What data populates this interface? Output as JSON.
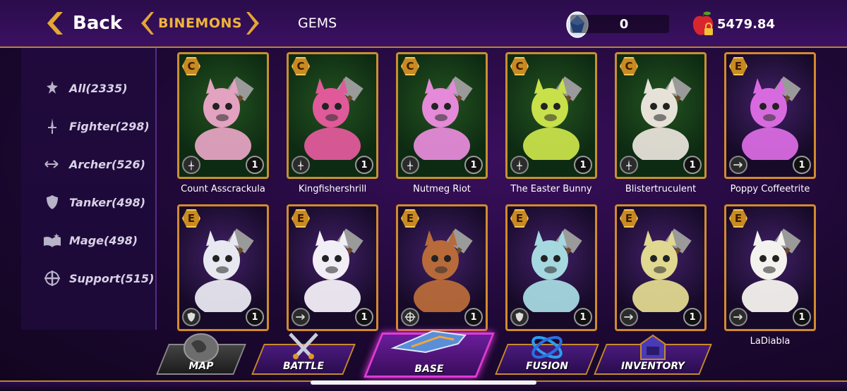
{
  "header": {
    "back_label": "Back",
    "tab_active": "BINEMONS",
    "tab_other": "GEMS",
    "gem_count": "0",
    "coin_balance": "5479.84"
  },
  "filters": [
    {
      "label": "All(2335)",
      "icon": "all-classes-icon"
    },
    {
      "label": "Fighter(298)",
      "icon": "sword-icon"
    },
    {
      "label": "Archer(526)",
      "icon": "arrow-icon"
    },
    {
      "label": "Tanker(498)",
      "icon": "shield-icon"
    },
    {
      "label": "Mage(498)",
      "icon": "spellbook-icon"
    },
    {
      "label": "Support(515)",
      "icon": "cross-icon"
    }
  ],
  "cards": [
    {
      "name": "Count Asscrackula",
      "rarity": "C",
      "level": "1",
      "class_icon": "sword-icon",
      "color": "#e3a2c0"
    },
    {
      "name": "Kingfishershrill",
      "rarity": "C",
      "level": "1",
      "class_icon": "sword-icon",
      "color": "#e05a9a"
    },
    {
      "name": "Nutmeg Riot",
      "rarity": "C",
      "level": "1",
      "class_icon": "sword-icon",
      "color": "#e48ad8"
    },
    {
      "name": "The Easter Bunny",
      "rarity": "C",
      "level": "1",
      "class_icon": "sword-icon",
      "color": "#c8e04a"
    },
    {
      "name": "Blistertruculent",
      "rarity": "C",
      "level": "1",
      "class_icon": "sword-icon",
      "color": "#e6e2d8"
    },
    {
      "name": "Poppy Coffeetrite",
      "rarity": "E",
      "level": "1",
      "class_icon": "arrow-icon",
      "color": "#d86ae0"
    },
    {
      "name": "",
      "rarity": "E",
      "level": "1",
      "class_icon": "shield-icon",
      "color": "#e8e8f0"
    },
    {
      "name": "",
      "rarity": "E",
      "level": "1",
      "class_icon": "arrow-icon",
      "color": "#f2eef6"
    },
    {
      "name": "",
      "rarity": "E",
      "level": "1",
      "class_icon": "cross-icon",
      "color": "#b86a3a"
    },
    {
      "name": "",
      "rarity": "E",
      "level": "1",
      "class_icon": "shield-icon",
      "color": "#a6d8e0"
    },
    {
      "name": "",
      "rarity": "E",
      "level": "1",
      "class_icon": "arrow-icon",
      "color": "#e0d890"
    },
    {
      "name": "LaDiabla",
      "rarity": "E",
      "level": "1",
      "class_icon": "arrow-icon",
      "color": "#f4f2ee"
    }
  ],
  "nav": {
    "map": "MAP",
    "battle": "BATTLE",
    "base": "BASE",
    "fusion": "FUSION",
    "inventory": "INVENTORY"
  },
  "colors": {
    "accent_gold": "#c8902e",
    "active_tab": "#f0b43a",
    "base_highlight": "#e03ad8"
  }
}
